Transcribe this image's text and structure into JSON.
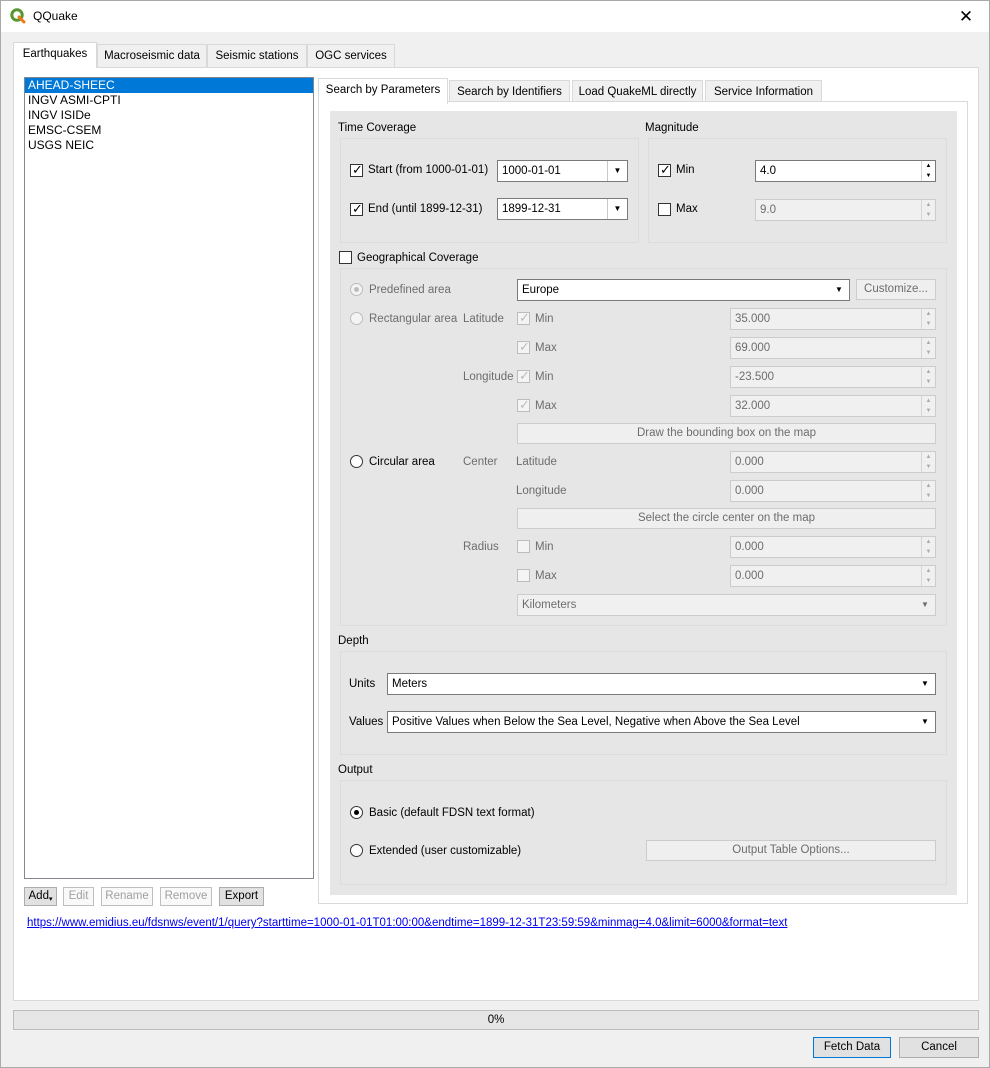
{
  "window": {
    "title": "QQuake",
    "close_glyph": "✕",
    "app_icon": "qgis-q-icon"
  },
  "main_tabs": [
    "Earthquakes",
    "Macroseismic data",
    "Seismic stations",
    "OGC services"
  ],
  "services": [
    "AHEAD-SHEEC",
    "INGV ASMI-CPTI",
    "INGV ISIDe",
    "EMSC-CSEM",
    "USGS NEIC"
  ],
  "list_buttons": {
    "add": "Add",
    "edit": "Edit",
    "rename": "Rename",
    "remove": "Remove",
    "export": "Export"
  },
  "sub_tabs": [
    "Search by Parameters",
    "Search by Identifiers",
    "Load QuakeML directly",
    "Service Information"
  ],
  "time_coverage": {
    "title": "Time Coverage",
    "start_label": "Start (from 1000-01-01)",
    "start_value": "1000-01-01",
    "end_label": "End (until 1899-12-31)",
    "end_value": "1899-12-31"
  },
  "magnitude": {
    "title": "Magnitude",
    "min_label": "Min",
    "min_value": "4.0",
    "max_label": "Max",
    "max_value": "9.0"
  },
  "geo": {
    "title": "Geographical Coverage",
    "predefined_label": "Predefined area",
    "predefined_value": "Europe",
    "customize": "Customize...",
    "rect_label": "Rectangular area",
    "latitude": "Latitude",
    "longitude": "Longitude",
    "min": "Min",
    "max": "Max",
    "lat_min": "35.000",
    "lat_max": "69.000",
    "lon_min": "-23.500",
    "lon_max": "32.000",
    "draw_bbox": "Draw the bounding box on the map",
    "circ_label": "Circular area",
    "center": "Center",
    "center_lat_label": "Latitude",
    "center_lon_label": "Longitude",
    "center_lat": "0.000",
    "center_lon": "0.000",
    "select_center": "Select the circle center on the map",
    "radius": "Radius",
    "radius_min": "0.000",
    "radius_max": "0.000",
    "radius_units": "Kilometers"
  },
  "depth": {
    "title": "Depth",
    "units_label": "Units",
    "units_value": "Meters",
    "values_label": "Values",
    "values_value": "Positive Values when Below the Sea Level, Negative when Above the Sea Level"
  },
  "output": {
    "title": "Output",
    "basic": "Basic (default FDSN text format)",
    "extended": "Extended (user customizable)",
    "table_options": "Output Table Options..."
  },
  "query_url": "https://www.emidius.eu/fdsnws/event/1/query?starttime=1000-01-01T01:00:00&endtime=1899-12-31T23:59:59&minmag=4.0&limit=6000&format=text",
  "progress": {
    "value": 0,
    "label": "0%"
  },
  "footer": {
    "fetch": "Fetch Data",
    "cancel": "Cancel"
  },
  "colors": {
    "accent": "#0078d7",
    "link": "#0000ee",
    "qgis_green": "#589632"
  }
}
